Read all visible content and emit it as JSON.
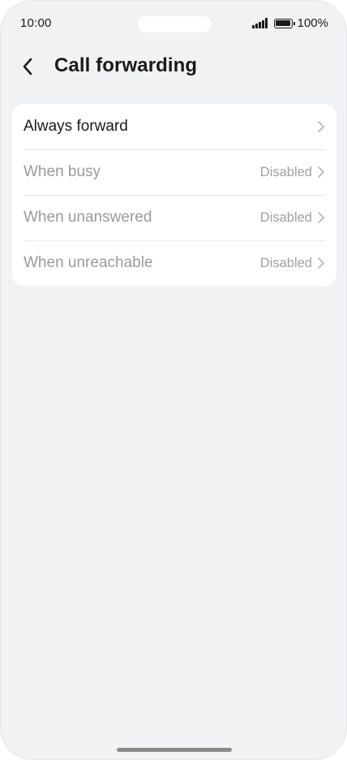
{
  "status_bar": {
    "time": "10:00",
    "battery": "100%",
    "signal_icon": "signal-bars-icon",
    "battery_icon": "battery-full-icon"
  },
  "header": {
    "title": "Call forwarding",
    "back_icon": "chevron-left-icon"
  },
  "settings": {
    "items": [
      {
        "label": "Always forward",
        "value": "",
        "enabled": true
      },
      {
        "label": "When busy",
        "value": "Disabled",
        "enabled": false
      },
      {
        "label": "When unanswered",
        "value": "Disabled",
        "enabled": false
      },
      {
        "label": "When unreachable",
        "value": "Disabled",
        "enabled": false
      }
    ]
  },
  "colors": {
    "background": "#f1f2f4",
    "card": "#ffffff",
    "text_primary": "#1a1a1a",
    "text_disabled": "#9a9a9a"
  }
}
